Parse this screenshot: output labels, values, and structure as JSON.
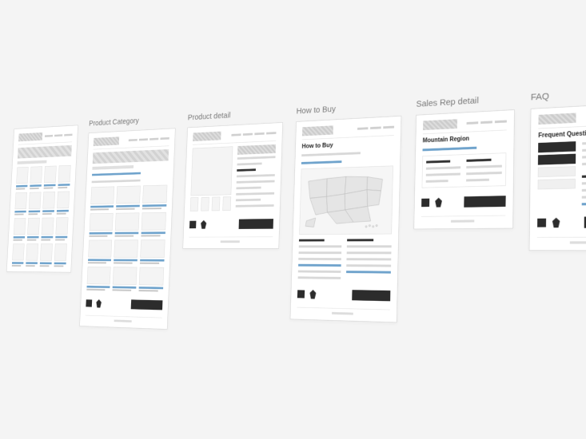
{
  "canvas": {
    "background": "#f4f4f4"
  },
  "wireframes": {
    "product_grid": {
      "label": "",
      "cols": 4,
      "rows": 4
    },
    "product_category": {
      "label": "Product Category",
      "cols": 3,
      "rows": 4
    },
    "product_detail": {
      "label": "Product detail",
      "thumbs": 4
    },
    "how_to_buy": {
      "label": "How to Buy",
      "page_title": "How to Buy"
    },
    "sales_rep": {
      "label": "Sales Rep detail",
      "page_title": "Mountain Region"
    },
    "faq": {
      "label": "FAQ",
      "page_title": "Frequent Questions"
    }
  },
  "colors": {
    "accent": "#6fa3cc",
    "dark": "#2c2c2c",
    "paper": "#ffffff",
    "line": "#d8d8d8"
  }
}
